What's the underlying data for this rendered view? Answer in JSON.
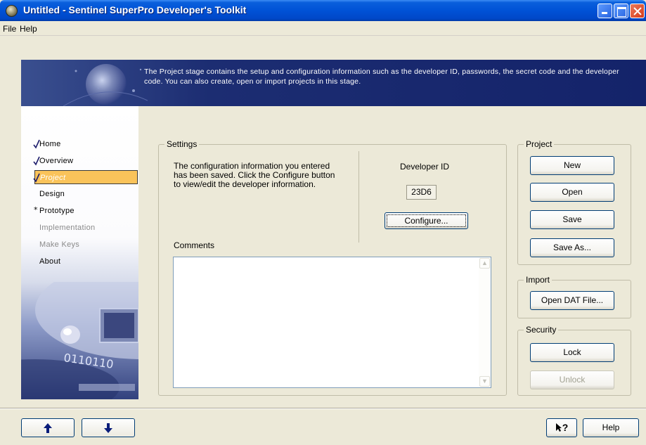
{
  "window": {
    "title": "Untitled - Sentinel SuperPro Developer's Toolkit"
  },
  "menu": {
    "items": [
      "File",
      "Help"
    ]
  },
  "banner": {
    "text": "The Project stage contains the setup and configuration information such as the developer ID, passwords, the secret code and the developer code. You can also create, open or import projects in this stage."
  },
  "nav": {
    "items": [
      {
        "label": "Home",
        "mark": "check",
        "state": "normal"
      },
      {
        "label": "Overview",
        "mark": "check",
        "state": "normal"
      },
      {
        "label": "Project",
        "mark": "check",
        "state": "active"
      },
      {
        "label": "Design",
        "mark": "none",
        "state": "normal"
      },
      {
        "label": "Prototype",
        "mark": "asterisk",
        "state": "normal"
      },
      {
        "label": "Implementation",
        "mark": "none",
        "state": "disabled"
      },
      {
        "label": "Make Keys",
        "mark": "none",
        "state": "disabled"
      },
      {
        "label": "About",
        "mark": "none",
        "state": "normal"
      }
    ]
  },
  "settings": {
    "label": "Settings",
    "message": "The configuration information you entered has been saved. Click the Configure button to view/edit the developer information.",
    "developer_id_label": "Developer ID",
    "developer_id_value": "23D6",
    "configure_label": "Configure...",
    "comments_label": "Comments",
    "comments_value": ""
  },
  "project": {
    "label": "Project",
    "new_label": "New",
    "open_label": "Open",
    "save_label": "Save",
    "save_as_label": "Save As..."
  },
  "import": {
    "label": "Import",
    "open_dat_label": "Open DAT File..."
  },
  "security": {
    "label": "Security",
    "lock_label": "Lock",
    "unlock_label": "Unlock"
  },
  "bottom": {
    "back_icon": "arrow-up-icon",
    "next_icon": "arrow-down-icon",
    "context_help_icon": "pointer-question-icon",
    "context_help_label": "?",
    "help_label": "Help"
  },
  "colors": {
    "titlebar": "#0052d6",
    "banner": "#14236a",
    "active_nav": "#fac35a",
    "face": "#ece9d8"
  }
}
